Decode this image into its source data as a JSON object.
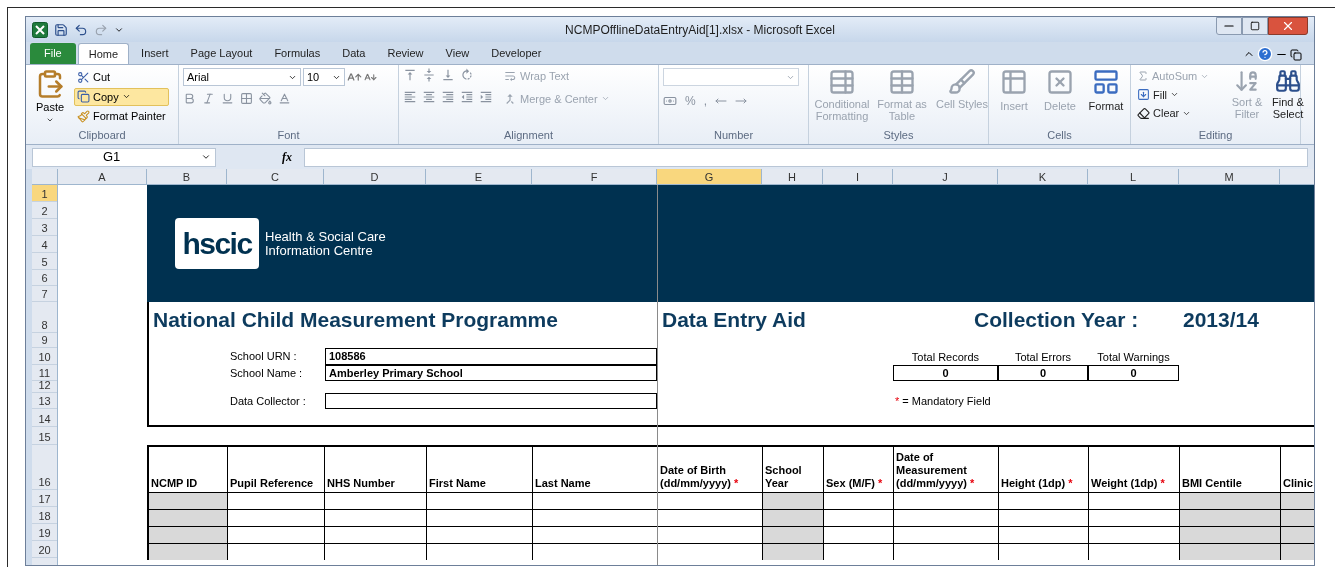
{
  "window": {
    "title": "NCMPOfflineDataEntryAid[1].xlsx  -  Microsoft Excel"
  },
  "ribbon_tabs": [
    {
      "label": "File",
      "kind": "file",
      "selected": false
    },
    {
      "label": "Home",
      "kind": "tab",
      "selected": true
    },
    {
      "label": "Insert",
      "kind": "tab",
      "selected": false
    },
    {
      "label": "Page Layout",
      "kind": "tab",
      "selected": false
    },
    {
      "label": "Formulas",
      "kind": "tab",
      "selected": false
    },
    {
      "label": "Data",
      "kind": "tab",
      "selected": false
    },
    {
      "label": "Review",
      "kind": "tab",
      "selected": false
    },
    {
      "label": "View",
      "kind": "tab",
      "selected": false
    },
    {
      "label": "Developer",
      "kind": "tab",
      "selected": false
    }
  ],
  "ribbon_groups": [
    {
      "kind": "clipboard",
      "label": "Clipboard",
      "items": [
        {
          "label": "Paste",
          "highlighted": false
        },
        {
          "label": "Cut",
          "highlighted": false
        },
        {
          "label": "Copy",
          "highlighted": true
        },
        {
          "label": "Format Painter",
          "highlighted": false
        }
      ]
    },
    {
      "kind": "font",
      "label": "Font",
      "font_name": "Arial",
      "font_size": "10"
    },
    {
      "kind": "alignment",
      "label": "Alignment",
      "items": [
        {
          "label": "Wrap Text",
          "disabled": true
        },
        {
          "label": "Merge & Center",
          "disabled": true
        }
      ]
    },
    {
      "kind": "number",
      "label": "Number",
      "symbols": [
        "%",
        ","
      ]
    },
    {
      "kind": "styles",
      "label": "Styles",
      "items": [
        {
          "label": "Conditional Formatting",
          "disabled": true
        },
        {
          "label": "Format as Table",
          "disabled": true
        },
        {
          "label": "Cell Styles",
          "disabled": true
        }
      ]
    },
    {
      "kind": "cells",
      "label": "Cells",
      "items": [
        {
          "label": "Insert",
          "disabled": true
        },
        {
          "label": "Delete",
          "disabled": true
        },
        {
          "label": "Format",
          "disabled": false
        }
      ]
    },
    {
      "kind": "editing",
      "label": "Editing",
      "items": [
        {
          "label": "AutoSum",
          "disabled": true
        },
        {
          "label": "Fill",
          "disabled": false
        },
        {
          "label": "Clear",
          "disabled": false
        },
        {
          "label": "Sort & Filter",
          "disabled": true
        },
        {
          "label": "Find & Select",
          "disabled": false
        }
      ]
    }
  ],
  "formula_bar": {
    "name_box": "G1",
    "fx": "fx"
  },
  "columns": [
    {
      "label": "A",
      "selected": false
    },
    {
      "label": "B",
      "selected": false
    },
    {
      "label": "C",
      "selected": false
    },
    {
      "label": "D",
      "selected": false
    },
    {
      "label": "E",
      "selected": false
    },
    {
      "label": "F",
      "selected": false
    },
    {
      "label": "G",
      "selected": true
    },
    {
      "label": "H",
      "selected": false
    },
    {
      "label": "I",
      "selected": false
    },
    {
      "label": "J",
      "selected": false
    },
    {
      "label": "K",
      "selected": false
    },
    {
      "label": "L",
      "selected": false
    },
    {
      "label": "M",
      "selected": false
    }
  ],
  "rows": [
    {
      "label": "1",
      "selected": true
    },
    {
      "label": "2",
      "selected": false
    },
    {
      "label": "3",
      "selected": false
    },
    {
      "label": "4",
      "selected": false
    },
    {
      "label": "5",
      "selected": false
    },
    {
      "label": "6",
      "selected": false
    },
    {
      "label": "7",
      "selected": false
    },
    {
      "label": "8",
      "selected": false
    },
    {
      "label": "9",
      "selected": false
    },
    {
      "label": "10",
      "selected": false
    },
    {
      "label": "11",
      "selected": false
    },
    {
      "label": "12",
      "selected": false
    },
    {
      "label": "13",
      "selected": false
    },
    {
      "label": "14",
      "selected": false
    },
    {
      "label": "15",
      "selected": false
    },
    {
      "label": "16",
      "selected": false
    },
    {
      "label": "17",
      "selected": false
    },
    {
      "label": "18",
      "selected": false
    },
    {
      "label": "19",
      "selected": false
    },
    {
      "label": "20",
      "selected": false
    }
  ],
  "sheet": {
    "logo": {
      "mark": "hscic",
      "lines": [
        "Health & Social Care",
        "Information Centre"
      ]
    },
    "title": "National Child Measurement Programme",
    "subtitle": "Data Entry Aid",
    "collection_label": "Collection Year :",
    "collection_year": "2013/14",
    "fields": [
      {
        "label": "School URN :",
        "value": "108586"
      },
      {
        "label": "School Name :",
        "value": "Amberley Primary School"
      },
      {
        "label": "Data Collector :"
      }
    ],
    "totals": [
      {
        "label": "Total Records",
        "value": "0"
      },
      {
        "label": "Total Errors",
        "value": "0"
      },
      {
        "label": "Total Warnings",
        "value": "0"
      }
    ],
    "mandatory_note": {
      "mark": "*",
      "text": "= Mandatory Field"
    },
    "table_columns": [
      {
        "label": "NCMP ID",
        "shaded": true
      },
      {
        "label": "Pupil Reference",
        "shaded": false
      },
      {
        "label": "NHS Number",
        "shaded": false
      },
      {
        "label": "First Name",
        "shaded": false
      },
      {
        "label": "Last Name",
        "shaded": false
      },
      {
        "label": "Date of Birth (dd/mm/yyyy)",
        "mark": "*",
        "shaded": false
      },
      {
        "label": "School Year",
        "shaded": true
      },
      {
        "label": "Sex (M/F)",
        "mark": "*",
        "shaded": false
      },
      {
        "label": "Date of Measurement (dd/mm/yyyy)",
        "mark": "*",
        "shaded": false
      },
      {
        "label": "Height (1dp)",
        "mark": "*",
        "shaded": false
      },
      {
        "label": "Weight (1dp)",
        "mark": "*",
        "shaded": false
      },
      {
        "label": "BMI Centile",
        "shaded": true
      },
      {
        "label": "Clinic",
        "shaded": true
      }
    ]
  }
}
